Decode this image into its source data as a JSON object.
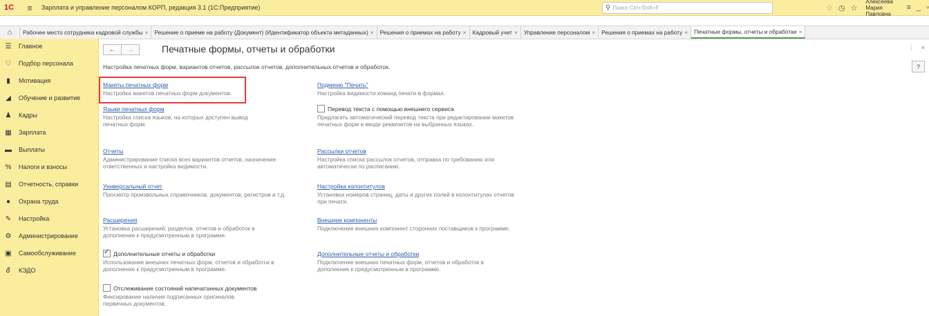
{
  "titlebar": {
    "logo": "1С",
    "app_title": "Зарплата и управление персоналом КОРП, редакция 3.1  (1С:Предприятие)",
    "search_placeholder": "Поиск Ctrl+Shift+F",
    "user": "Алексеева Мария Павловна"
  },
  "tabs": [
    {
      "label": "Рабочее место сотрудника кадровой службы"
    },
    {
      "label": "Решение о приеме на работу (Документ) (Идентификатор объекта метаданных)"
    },
    {
      "label": "Решения о приемах на работу"
    },
    {
      "label": "Кадровый учет"
    },
    {
      "label": "Управление персоналом"
    },
    {
      "label": "Решения о приемах на работу"
    },
    {
      "label": "Печатные формы, отчеты и обработки"
    }
  ],
  "sidebar": {
    "items": [
      {
        "label": "Главное",
        "icon": "☰"
      },
      {
        "label": "Подбор персонала",
        "icon": "♡"
      },
      {
        "label": "Мотивация",
        "icon": "▮"
      },
      {
        "label": "Обучение и развитие",
        "icon": "◢"
      },
      {
        "label": "Кадры",
        "icon": "♟"
      },
      {
        "label": "Зарплата",
        "icon": "▦"
      },
      {
        "label": "Выплаты",
        "icon": "▬"
      },
      {
        "label": "Налоги и взносы",
        "icon": "%"
      },
      {
        "label": "Отчетность, справки",
        "icon": "▤"
      },
      {
        "label": "Охрана труда",
        "icon": "●"
      },
      {
        "label": "Настройка",
        "icon": "✎"
      },
      {
        "label": "Администрирование",
        "icon": "⚙"
      },
      {
        "label": "Самообслуживание",
        "icon": "▣"
      },
      {
        "label": "КЭДО",
        "icon": "Ꮄ"
      }
    ]
  },
  "page": {
    "title": "Печатные формы, отчеты и обработки",
    "description": "Настройка печатных форм, вариантов отчетов, рассылок отчетов, дополнительных отчетов и обработок.",
    "help": "?"
  },
  "left": {
    "makety": {
      "link": "Макеты печатных форм",
      "desc": "Настройка макетов печатных форм документов."
    },
    "yazyki": {
      "link": "Языки печатных форм",
      "desc": "Настройка списка языков, на которых доступен вывод печатных форм."
    },
    "otchety": {
      "link": "Отчеты",
      "desc": "Администрирование списка всех вариантов отчетов, назначение ответственных и настройка видимости."
    },
    "universal": {
      "link": "Универсальный отчет",
      "desc": "Просмотр произвольных справочников, документов, регистров и т.д."
    },
    "rasshireniya": {
      "link": "Расширения",
      "desc": "Установка расширений: разделов, отчетов и обработок в дополнение к предусмотренным в программе."
    },
    "dop": {
      "label": "Дополнительные отчеты и обработки",
      "desc": "Использование внешних печатных форм, отчетов и обработок в дополнение к предусмотренным в программе."
    },
    "otslezh": {
      "label": "Отслеживание состояний напечатанных документов",
      "desc": "Фиксирование наличия подписанных оригиналов первичных документов."
    }
  },
  "right": {
    "podmenu": {
      "link": "Подменю \"Печать\"",
      "desc": "Настройка видимости команд печати в формах."
    },
    "perevod": {
      "label": "Перевод текста с помощью внешнего сервиса",
      "desc": "Предлагать автоматический перевод текста при редактировании макетов печатных форм и вводе реквизитов на выбранных языках."
    },
    "rassylki": {
      "link": "Рассылки отчетов",
      "desc": "Настройка списка рассылок отчетов, отправка по требованию или автоматически по расписанию."
    },
    "kolontituly": {
      "link": "Настройка колонтитулов",
      "desc": "Установка номеров страниц, даты и других полей в колонтитулах отчетов при печати."
    },
    "vneshnie": {
      "link": "Внешние компоненты",
      "desc": "Подключение внешних компонент сторонних поставщиков к программе."
    },
    "dop_link": {
      "link": "Дополнительные отчеты и обработки",
      "desc": "Подключение внешних печатных форм, отчетов и обработок в дополнение к предусмотренным в программе."
    }
  }
}
